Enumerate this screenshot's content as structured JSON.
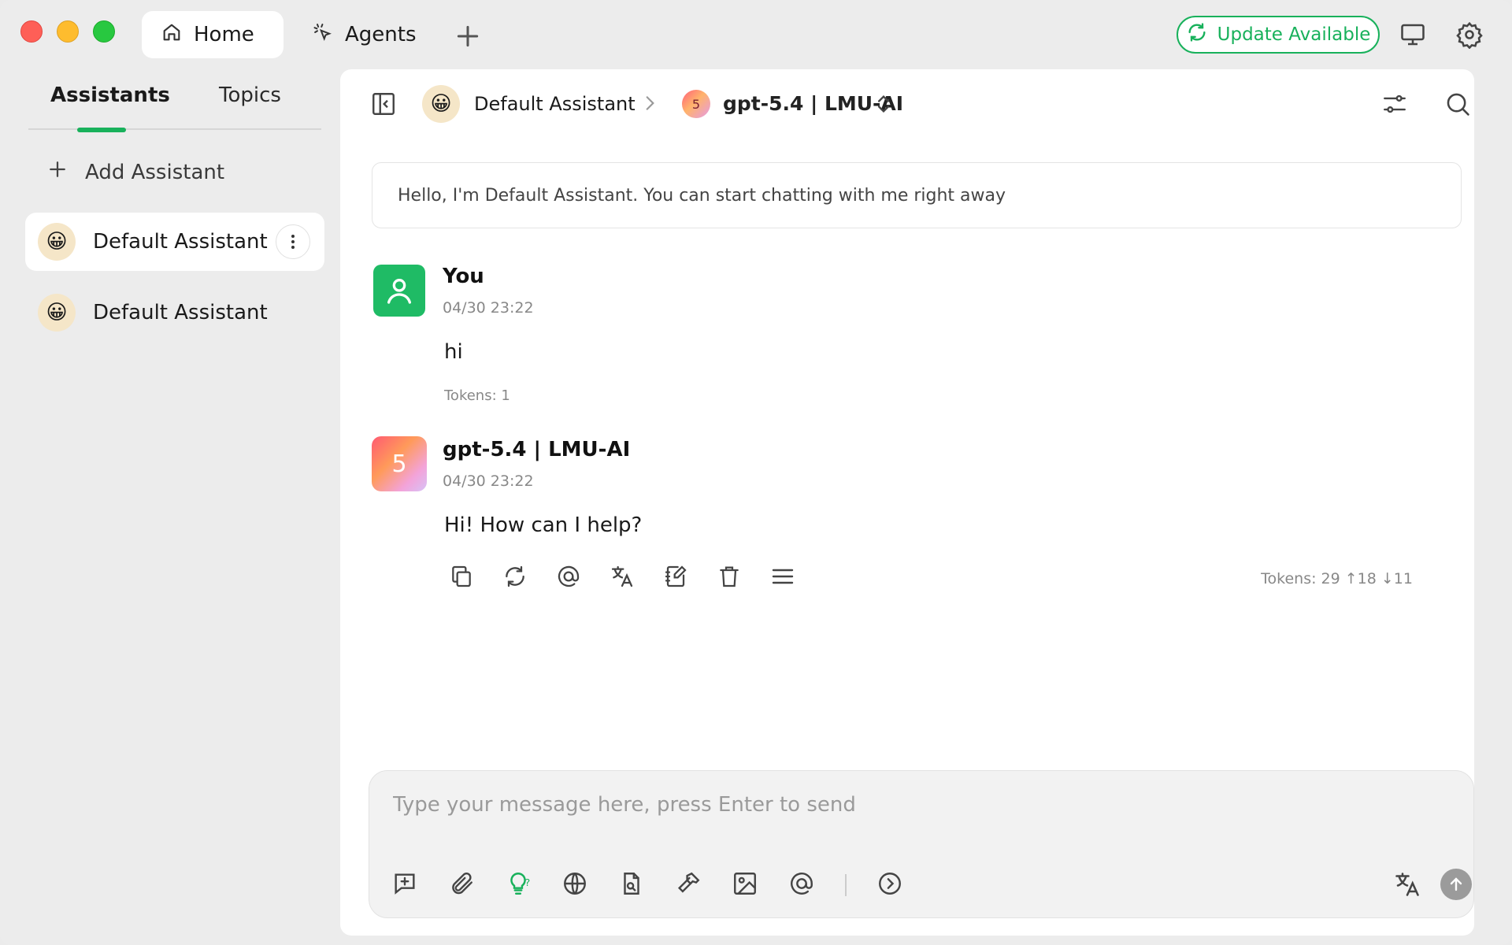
{
  "titlebar": {
    "tabs": [
      {
        "label": "Home",
        "icon": "home-icon"
      },
      {
        "label": "Agents",
        "icon": "cursor-click-icon"
      }
    ],
    "update_label": "Update Available",
    "accent": "#18b15b"
  },
  "sidebar": {
    "tab_assistants": "Assistants",
    "tab_topics": "Topics",
    "add_assistant": "Add Assistant",
    "items": [
      {
        "label": "Default Assistant",
        "avatar": "😀",
        "active": true
      },
      {
        "label": "Default Assistant",
        "avatar": "😀",
        "active": false
      }
    ]
  },
  "header": {
    "assistant_avatar": "😀",
    "assistant_name": "Default Assistant",
    "model_badge": "5",
    "model_name": "gpt-5.4 | LMU-AI"
  },
  "chat": {
    "welcome": "Hello, I'm Default Assistant. You can start chatting with me right away",
    "messages": [
      {
        "author": "You",
        "time": "04/30 23:22",
        "text": "hi",
        "tokens": "Tokens: 1"
      },
      {
        "author": "gpt-5.4 | LMU-AI",
        "avatar_text": "5",
        "time": "04/30 23:22",
        "text": "Hi! How can I help?",
        "tokens": "Tokens: 29 ↑18 ↓11"
      }
    ]
  },
  "input": {
    "placeholder": "Type your message here, press Enter to send"
  }
}
